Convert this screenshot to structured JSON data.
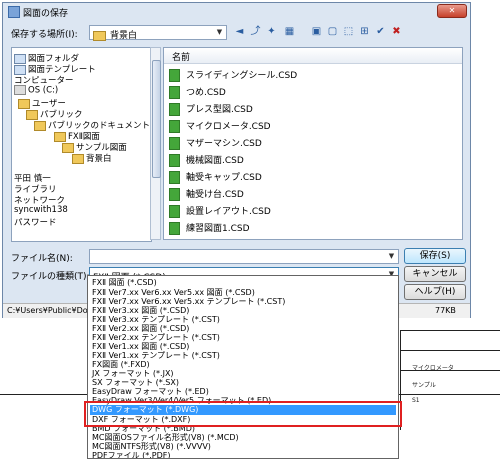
{
  "dialog": {
    "title": "図面の保存",
    "location_label": "保存する場所(I):",
    "location_value": "背景白",
    "column_name": "名前",
    "filename_label": "ファイル名(N):",
    "filetype_label": "ファイルの種類(T):",
    "filetype_value": "FXⅡ 図面 (*.CSD)",
    "save_button": "保存(S)",
    "cancel_button": "キャンセル",
    "help_button": "ヘルプ(H)",
    "status_path": "C:¥Users¥Public¥Docu",
    "status_size": "77KB"
  },
  "toolbar": {
    "back": "◄",
    "up": "⤴",
    "newfolder": "✦",
    "views": "▦",
    "t1": "▣",
    "t2": "▢",
    "t3": "⬚",
    "t4": "⊞",
    "t5": "✔",
    "t6": "✖"
  },
  "tree": [
    "図面フォルダ",
    "図面テンプレート",
    "コンピューター",
    "OS (C:)",
    "ユーザー",
    "パブリック",
    "パブリックのドキュメント",
    "FXⅡ図面",
    "サンプル図面",
    "背景白",
    "",
    "平田 慎一",
    "ライブラリ",
    "ネットワーク",
    "syncwith138",
    "パスワード"
  ],
  "files": [
    "スライディングシール.CSD",
    "つめ.CSD",
    "プレス型図.CSD",
    "マイクロメータ.CSD",
    "マザーマシン.CSD",
    "機械図面.CSD",
    "軸受キャップ.CSD",
    "軸受け台.CSD",
    "設置レイアウト.CSD",
    "練習図面1.CSD"
  ],
  "filetype_options": [
    "FXⅡ 図面 (*.CSD)",
    "FXⅡ Ver7.xx Ver6.xx Ver5.xx 図面 (*.CSD)",
    "FXⅡ Ver7.xx Ver6.xx Ver5.xx テンプレート (*.CST)",
    "FXⅡ Ver3.xx 図面 (*.CSD)",
    "FXⅡ Ver3.xx テンプレート (*.CST)",
    "FXⅡ Ver2.xx 図面 (*.CSD)",
    "FXⅡ Ver2.xx テンプレート (*.CST)",
    "FXⅡ Ver1.xx 図面 (*.CSD)",
    "FXⅡ Ver1.xx テンプレート (*.CST)",
    "FX図面 (*.FXD)",
    "JX フォーマット (*.JX)",
    "SX フォーマット (*.SX)",
    "EasyDraw フォーマット (*.ED)",
    "EasyDraw Ver3/Ver4/Ver5 フォーマット (*.ED)",
    "DWG フォーマット (*.DWG)",
    "DXF フォーマット (*.DXF)",
    "BMD フォーマット (*.BMD)",
    "MC図面OSファイル名形式(V8) (*.MCD)",
    "MC図面NTFS形式(V8) (*.VVVV)",
    "PDFファイル (*.PDF)"
  ],
  "selected_option_index": 14,
  "background_doc": {
    "cells": [
      "マイクロメータ",
      "サンプル",
      "S1"
    ]
  }
}
